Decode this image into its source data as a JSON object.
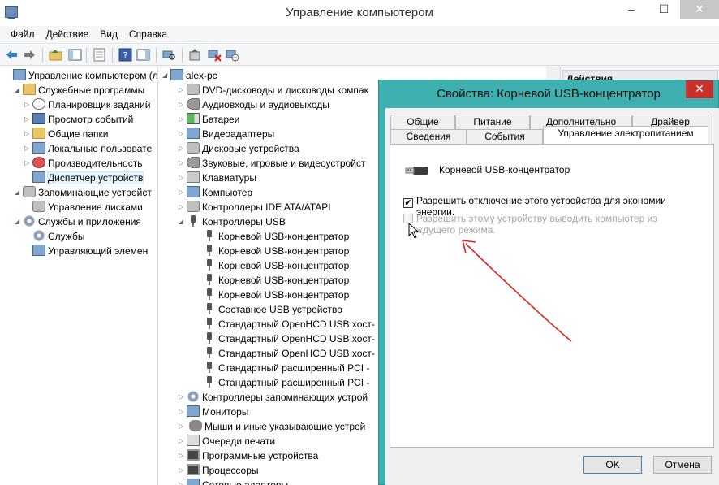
{
  "window": {
    "title": "Управление компьютером",
    "min": "–",
    "max": "☐",
    "close": "✕"
  },
  "menu": [
    "Файл",
    "Действие",
    "Вид",
    "Справка"
  ],
  "left_tree": [
    {
      "label": "Управление компьютером (л",
      "level": 0,
      "arrow": "",
      "icon": "i-screen"
    },
    {
      "label": "Служебные программы",
      "level": 1,
      "arrow": "◢",
      "icon": "i-folder"
    },
    {
      "label": "Планировщик заданий",
      "level": 2,
      "arrow": "▷",
      "icon": "i-clock"
    },
    {
      "label": "Просмотр событий",
      "level": 2,
      "arrow": "▷",
      "icon": "i-book"
    },
    {
      "label": "Общие папки",
      "level": 2,
      "arrow": "▷",
      "icon": "i-folder"
    },
    {
      "label": "Локальные пользовате",
      "level": 2,
      "arrow": "▷",
      "icon": "i-screen"
    },
    {
      "label": "Производительность",
      "level": 2,
      "arrow": "▷",
      "icon": "i-alert"
    },
    {
      "label": "Диспетчер устройств",
      "level": 2,
      "arrow": "",
      "icon": "i-screen",
      "selected": true
    },
    {
      "label": "Запоминающие устройст",
      "level": 1,
      "arrow": "◢",
      "icon": "i-disk"
    },
    {
      "label": "Управление дисками",
      "level": 2,
      "arrow": "",
      "icon": "i-disk"
    },
    {
      "label": "Службы и приложения",
      "level": 1,
      "arrow": "◢",
      "icon": "i-gear"
    },
    {
      "label": "Службы",
      "level": 2,
      "arrow": "",
      "icon": "i-gear"
    },
    {
      "label": "Управляющий элемен",
      "level": 2,
      "arrow": "",
      "icon": "i-screen"
    }
  ],
  "device_tree": [
    {
      "label": "alex-pc",
      "level": 0,
      "arrow": "◢",
      "icon": "i-screen"
    },
    {
      "label": "DVD-дисководы и дисководы компак",
      "level": 1,
      "arrow": "▷",
      "icon": "i-disk"
    },
    {
      "label": "Аудиовходы и аудиовыходы",
      "level": 1,
      "arrow": "▷",
      "icon": "i-sound"
    },
    {
      "label": "Батареи",
      "level": 1,
      "arrow": "▷",
      "icon": "i-battery"
    },
    {
      "label": "Видеоадаптеры",
      "level": 1,
      "arrow": "▷",
      "icon": "i-screen"
    },
    {
      "label": "Дисковые устройства",
      "level": 1,
      "arrow": "▷",
      "icon": "i-disk"
    },
    {
      "label": "Звуковые, игровые и видеоустройст",
      "level": 1,
      "arrow": "▷",
      "icon": "i-sound"
    },
    {
      "label": "Клавиатуры",
      "level": 1,
      "arrow": "▷",
      "icon": "i-keyboard"
    },
    {
      "label": "Компьютер",
      "level": 1,
      "arrow": "▷",
      "icon": "i-screen"
    },
    {
      "label": "Контроллеры IDE ATA/ATAPI",
      "level": 1,
      "arrow": "▷",
      "icon": "i-disk"
    },
    {
      "label": "Контроллеры USB",
      "level": 1,
      "arrow": "◢",
      "icon": "i-usb"
    },
    {
      "label": "Корневой USB-концентратор",
      "level": 2,
      "arrow": "",
      "icon": "i-usb"
    },
    {
      "label": "Корневой USB-концентратор",
      "level": 2,
      "arrow": "",
      "icon": "i-usb"
    },
    {
      "label": "Корневой USB-концентратор",
      "level": 2,
      "arrow": "",
      "icon": "i-usb"
    },
    {
      "label": "Корневой USB-концентратор",
      "level": 2,
      "arrow": "",
      "icon": "i-usb"
    },
    {
      "label": "Корневой USB-концентратор",
      "level": 2,
      "arrow": "",
      "icon": "i-usb"
    },
    {
      "label": "Составное USB устройство",
      "level": 2,
      "arrow": "",
      "icon": "i-usb"
    },
    {
      "label": "Стандартный OpenHCD USB хост-",
      "level": 2,
      "arrow": "",
      "icon": "i-usb"
    },
    {
      "label": "Стандартный OpenHCD USB хост-",
      "level": 2,
      "arrow": "",
      "icon": "i-usb"
    },
    {
      "label": "Стандартный OpenHCD USB хост-",
      "level": 2,
      "arrow": "",
      "icon": "i-usb"
    },
    {
      "label": "Стандартный расширенный PCI -",
      "level": 2,
      "arrow": "",
      "icon": "i-usb"
    },
    {
      "label": "Стандартный расширенный PCI -",
      "level": 2,
      "arrow": "",
      "icon": "i-usb"
    },
    {
      "label": "Контроллеры запоминающих устрой",
      "level": 1,
      "arrow": "▷",
      "icon": "i-gear"
    },
    {
      "label": "Мониторы",
      "level": 1,
      "arrow": "▷",
      "icon": "i-screen"
    },
    {
      "label": "Мыши и иные указывающие устрой",
      "level": 1,
      "arrow": "▷",
      "icon": "i-mouse"
    },
    {
      "label": "Очереди печати",
      "level": 1,
      "arrow": "▷",
      "icon": "i-printer"
    },
    {
      "label": "Программные устройства",
      "level": 1,
      "arrow": "▷",
      "icon": "i-chip"
    },
    {
      "label": "Процессоры",
      "level": 1,
      "arrow": "▷",
      "icon": "i-chip"
    },
    {
      "label": "Сетевые адаптеры",
      "level": 1,
      "arrow": "▷",
      "icon": "i-screen"
    }
  ],
  "actions": {
    "title": "Действия"
  },
  "dialog": {
    "title": "Свойства: Корневой USB-концентратор",
    "close": "✕",
    "tabs_row1": [
      "Общие",
      "Питание",
      "Дополнительно",
      "Драйвер"
    ],
    "tabs_row2": [
      "Сведения",
      "События",
      "Управление электропитанием"
    ],
    "active_tab": "Управление электропитанием",
    "device_name": "Корневой USB-концентратор",
    "option1": {
      "label": "Разрешить отключение этого устройства для экономии энергии.",
      "checked": true,
      "enabled": true
    },
    "option2": {
      "label": "Разрешить этому устройству выводить компьютер из ждущего режима.",
      "checked": false,
      "enabled": false
    },
    "ok": "OK",
    "cancel": "Отмена"
  },
  "annotation_color": "#e0241f"
}
